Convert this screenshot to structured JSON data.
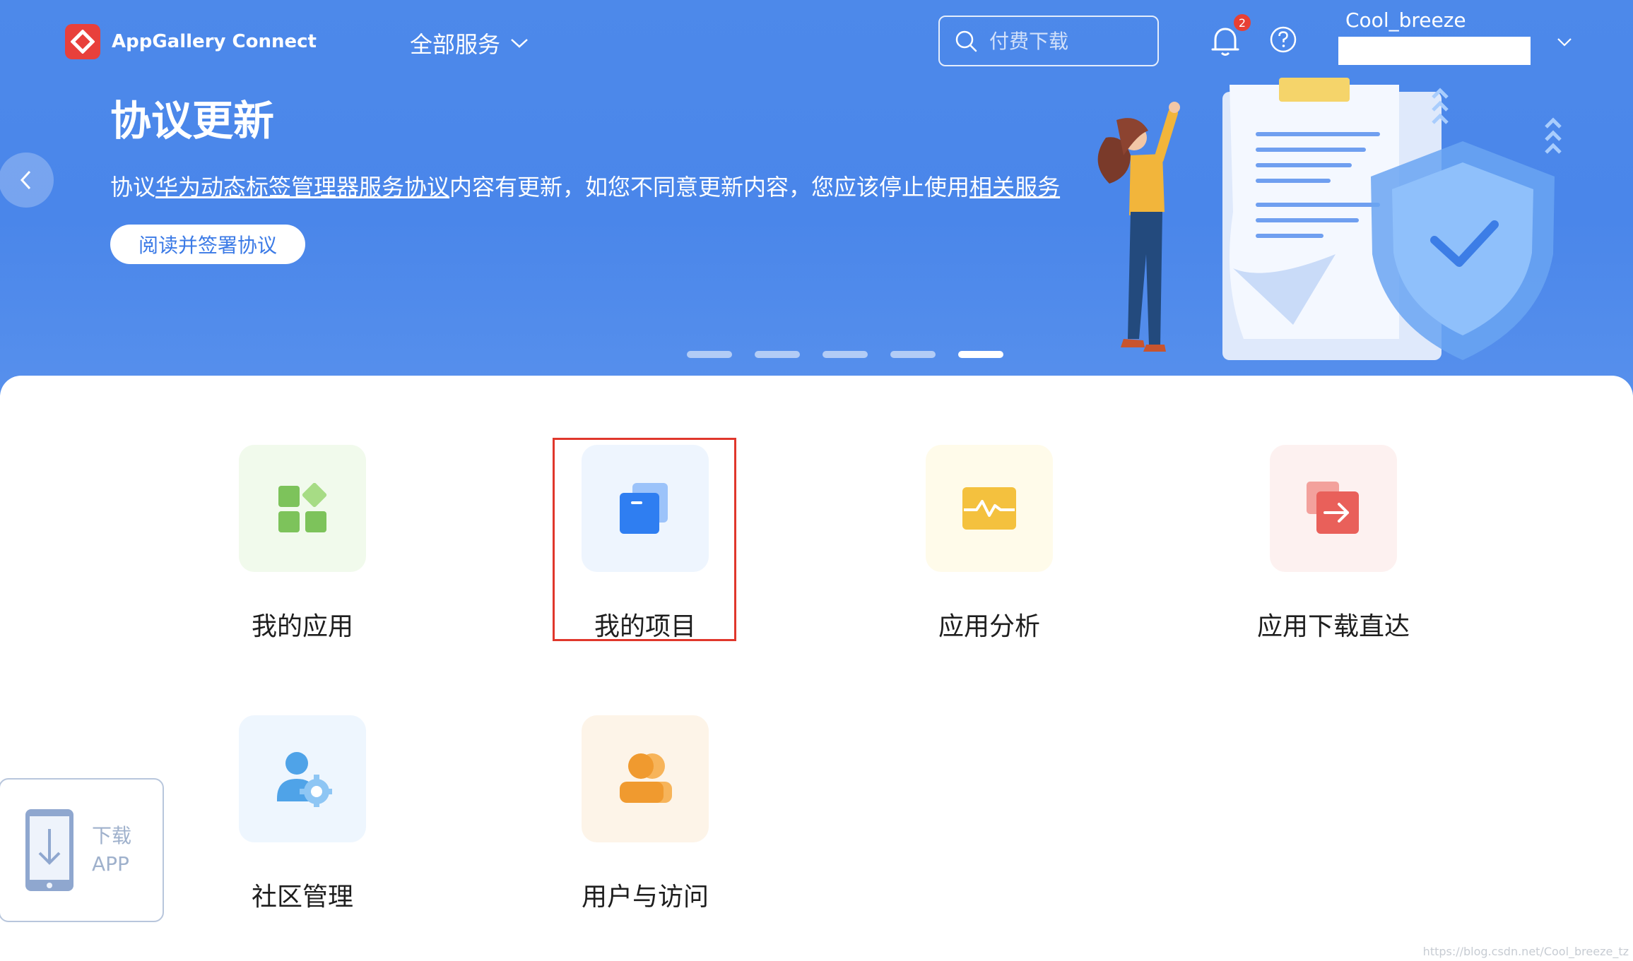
{
  "header": {
    "brand": "AppGallery Connect",
    "all_services": "全部服务",
    "search_placeholder": "付费下载",
    "notification_count": "2",
    "username": "Cool_breeze"
  },
  "banner": {
    "title": "协议更新",
    "desc_prefix": "协议",
    "desc_link1": "华为动态标签管理器服务协议",
    "desc_middle": "内容有更新，如您不同意更新内容，您应该停止使用",
    "desc_link2": "相关服务",
    "button": "阅读并签署协议",
    "slide_count": 5,
    "active_slide": 5
  },
  "tiles": [
    {
      "label": "我的应用",
      "icon": "apps-grid-icon",
      "color": "#7dc35b"
    },
    {
      "label": "我的项目",
      "icon": "project-folder-icon",
      "color": "#2f7ef1"
    },
    {
      "label": "应用分析",
      "icon": "analytics-pulse-icon",
      "color": "#f4c13e"
    },
    {
      "label": "应用下载直达",
      "icon": "download-direct-icon",
      "color": "#e9605a"
    },
    {
      "label": "社区管理",
      "icon": "community-admin-icon",
      "color": "#4fa3e8"
    },
    {
      "label": "用户与访问",
      "icon": "user-access-icon",
      "color": "#f09a2f"
    }
  ],
  "download_app": {
    "line1": "下载",
    "line2": "APP"
  },
  "watermark": "https://blog.csdn.net/Cool_breeze_tz"
}
